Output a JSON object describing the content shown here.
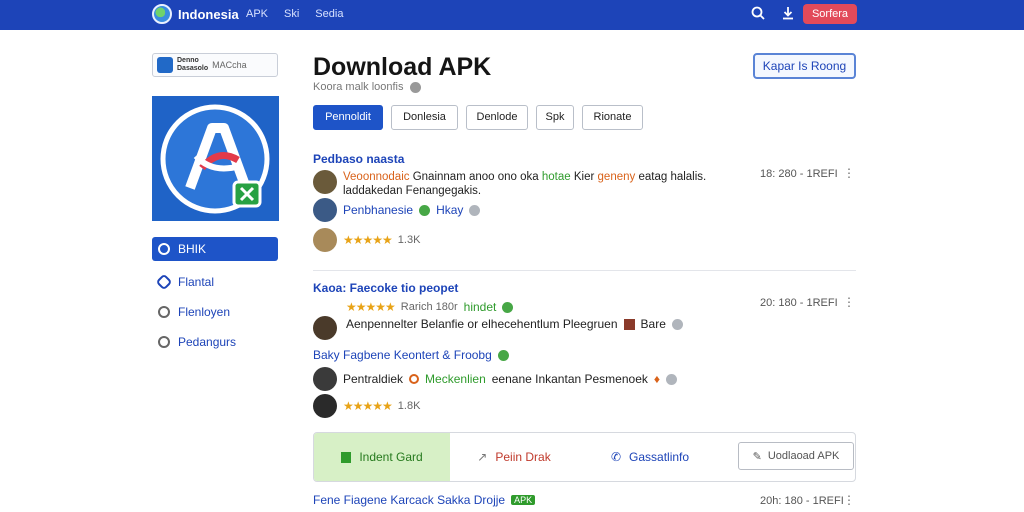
{
  "topbar": {
    "brand": "Indonesia",
    "nav": [
      "APK",
      "Ski",
      "Sedia"
    ],
    "button_label": "Sorfera",
    "icons": [
      "globe-icon",
      "search-icon",
      "download-icon"
    ]
  },
  "sidebar": {
    "chip_line1": "Denno",
    "chip_line2": "Dasasolo",
    "chip_label": "MACcha",
    "items": [
      {
        "label": "BHIK",
        "icon": "shield-icon"
      },
      {
        "label": "Flantal",
        "icon": "link-icon"
      },
      {
        "label": "Flenloyen",
        "icon": "heart-icon"
      },
      {
        "label": "Pedangurs",
        "icon": "clock-icon"
      }
    ]
  },
  "header": {
    "title": "Download APK",
    "subtitle": "Koora malk loonfis",
    "button_label": "Kapar Is Roong",
    "tabs": [
      "Pennoldit",
      "Donlesia",
      "Denlode",
      "Spk",
      "Rionate"
    ]
  },
  "sections": [
    {
      "title": "Pedbaso naasta",
      "meta": "18: 280 - 1REFI",
      "rows": [
        {
          "parts": [
            "Veoonnodaic",
            "Gnainnam anoo ono oka",
            "hotae",
            "Kier",
            "geneny",
            "eatag halalis. laddakedan Fenangegakis."
          ]
        },
        {
          "parts": [
            "Penbhanesie",
            "Hkay"
          ]
        },
        {
          "rating": "★★★★★",
          "count": "1.3K"
        }
      ]
    },
    {
      "title": "Kaoa: Faecoke tio peopet",
      "meta": "20: 180 - 1REFI",
      "rows": [
        {
          "rating": "★★★★★",
          "parts": [
            "Rarich 180r",
            "hindet"
          ]
        },
        {
          "parts": [
            "Aenpennelter Belanfie or elhecehentlum Pleegruen",
            "Bare"
          ]
        }
      ]
    },
    {
      "title": "Baky Fagbene Keontert & Froobg",
      "rows": [
        {
          "parts": [
            "Pentraldiek",
            "Meckenlien",
            "eenane Inkantan Pesmenoek"
          ]
        },
        {
          "rating": "★★★★★",
          "count": "1.8K"
        }
      ]
    }
  ],
  "actions": {
    "item1": "Indent Gard",
    "item2": "Peiin Drak",
    "item3": "Gassatlinfo",
    "download": "Uodlaoad APK"
  },
  "footer": {
    "title": "Fene Fiagene Karcack Sakka Drojje",
    "badge": "APK",
    "meta": "20h: 180 - 1REFI"
  }
}
